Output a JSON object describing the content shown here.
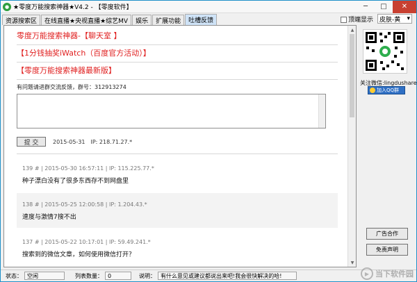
{
  "window": {
    "title": "★零度万能搜索神器★V4.2 - 【零度软件】"
  },
  "tabs": [
    {
      "label": "资源搜索区"
    },
    {
      "label": "在线直播★央视直播★综艺MV"
    },
    {
      "label": "娱乐"
    },
    {
      "label": "扩展功能"
    },
    {
      "label": "吐槽反馈"
    }
  ],
  "topright": {
    "checkbox_label": "顶端显示",
    "skin_select": "皮肤-黄"
  },
  "links": {
    "chatroom": "零度万能搜索神器-【聊天室 】",
    "lottery": "【1分钱抽奖iWatch（百度官方活动）】",
    "latest": "【零度万能搜索神器最新版】"
  },
  "group_line": "有问题请进群交流反馈，群号：312913274",
  "submit": {
    "button": "提 交",
    "date": "2015-05-31",
    "ip": "IP: 218.71.27.*"
  },
  "posts": [
    {
      "meta": "139 #  |  2015-05-30 16:57:11  |  IP: 115.225.77.*",
      "text": "种子漂白没有了很多东西存不到网盘里",
      "shaded": false
    },
    {
      "meta": "138 #  |  2015-05-25 12:00:58  |  IP: 1.204.43.*",
      "text": "速度与激情7搜不出",
      "shaded": true
    },
    {
      "meta": "137 #  |  2015-05-22 10:17:01  |  IP: 59.49.241.*",
      "text": "搜索到的微信文章，如何使用微信打开？",
      "shaded": false
    }
  ],
  "sidebar": {
    "follow": "关注微信:lingdushare",
    "qq_button": "加入QQ群",
    "ad_button": "广告合作",
    "disclaimer_button": "免责声明"
  },
  "status": {
    "state_label": "状态：",
    "state_value": "空闲",
    "count_label": "列表数量：",
    "count_value": "0",
    "desc_label": "说明：",
    "desc_value": "有什么意见或建议都说出来吧!我会很快解决的哈!"
  },
  "watermark": {
    "text": "当下软件园"
  },
  "colors": {
    "link_red": "#e02020",
    "title_blue": "#1e90c8",
    "close_red": "#c84031"
  }
}
